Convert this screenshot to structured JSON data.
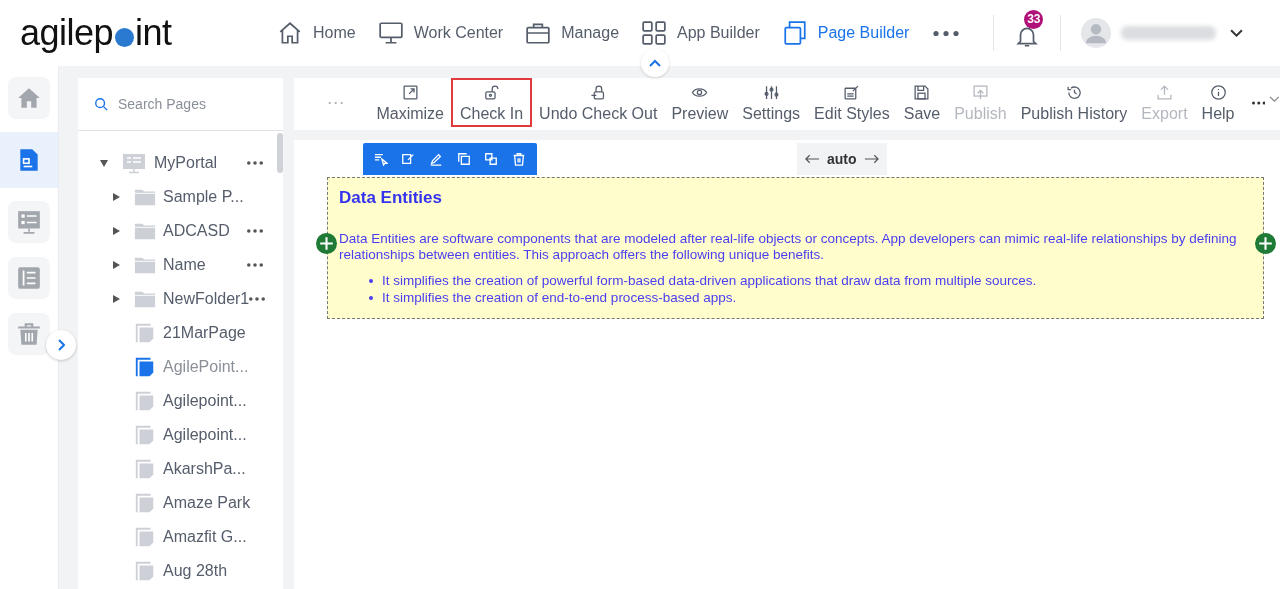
{
  "logo": {
    "before": "agilep",
    "after": "int"
  },
  "nav": [
    {
      "label": "Home",
      "selected": false
    },
    {
      "label": "Work Center",
      "selected": false
    },
    {
      "label": "Manage",
      "selected": false
    },
    {
      "label": "App Builder",
      "selected": false
    },
    {
      "label": "Page Builder",
      "selected": true
    }
  ],
  "notifications": {
    "count": "33"
  },
  "rail": [
    {
      "selected": false
    },
    {
      "selected": true
    },
    {
      "selected": false
    },
    {
      "selected": false
    },
    {
      "selected": false
    }
  ],
  "search": {
    "placeholder": "Search Pages"
  },
  "tree": [
    {
      "label": "MyPortal",
      "kind": "portal",
      "expanded": true,
      "menu": true,
      "children": [
        {
          "label": "Sample P...",
          "kind": "folder",
          "expanded": false,
          "menu": false
        },
        {
          "label": "ADCASD",
          "kind": "folder",
          "expanded": false,
          "menu": true
        },
        {
          "label": "Name",
          "kind": "folder",
          "expanded": false,
          "menu": true
        },
        {
          "label": "NewFolder1",
          "kind": "folder",
          "expanded": false,
          "menu": true
        },
        {
          "label": "21MarPage",
          "kind": "page",
          "selected": false
        },
        {
          "label": "AgilePoint...",
          "kind": "page",
          "selected": true
        },
        {
          "label": "Agilepoint...",
          "kind": "page",
          "selected": false
        },
        {
          "label": "Agilepoint...",
          "kind": "page",
          "selected": false
        },
        {
          "label": "AkarshPa...",
          "kind": "page",
          "selected": false
        },
        {
          "label": "Amaze Park",
          "kind": "page",
          "selected": false
        },
        {
          "label": "Amazfit G...",
          "kind": "page",
          "selected": false
        },
        {
          "label": "Aug 28th",
          "kind": "page",
          "selected": false
        }
      ]
    }
  ],
  "toolbar": [
    {
      "label": "Maximize",
      "disabled": false,
      "highlighted": false
    },
    {
      "label": "Check In",
      "disabled": false,
      "highlighted": true
    },
    {
      "label": "Undo Check Out",
      "disabled": false,
      "highlighted": false
    },
    {
      "label": "Preview",
      "disabled": false,
      "highlighted": false
    },
    {
      "label": "Settings",
      "disabled": false,
      "highlighted": false
    },
    {
      "label": "Edit Styles",
      "disabled": false,
      "highlighted": false
    },
    {
      "label": "Save",
      "disabled": false,
      "highlighted": false
    },
    {
      "label": "Publish",
      "disabled": true,
      "highlighted": false
    },
    {
      "label": "Publish History",
      "disabled": false,
      "highlighted": false
    },
    {
      "label": "Export",
      "disabled": true,
      "highlighted": false
    },
    {
      "label": "Help",
      "disabled": false,
      "highlighted": false
    }
  ],
  "width_control": {
    "value": "auto"
  },
  "block": {
    "title": "Data Entities",
    "paragraph": "Data Entities are software components that are modeled after real-life objects or concepts. App developers can mimic real-life relationships by defining relationships between entities. This approach offers the following unique benefits.",
    "bullets": [
      "It simplifies the creation of powerful form-based data-driven applications that draw data from multiple sources.",
      "It simplifies the creation of end-to-end process-based apps."
    ]
  }
}
